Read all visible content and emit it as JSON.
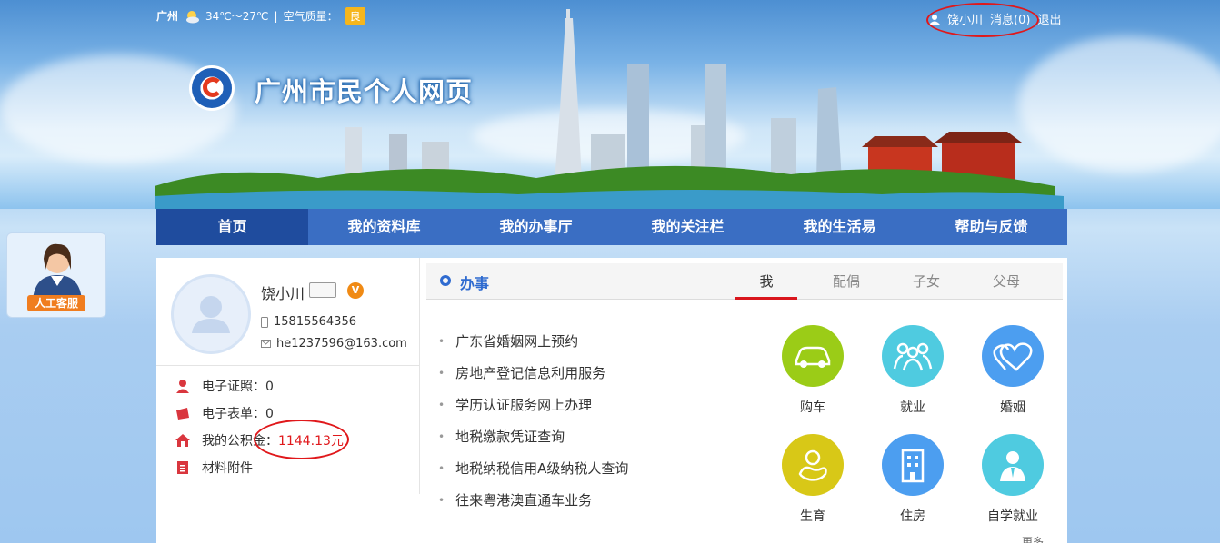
{
  "top": {
    "city": "广州",
    "weather": "34℃～27℃",
    "separator": "|",
    "air_quality_label": "空气质量：",
    "air_quality_value": "良",
    "user": "饶小川",
    "messages": "消息(0)",
    "logout": "退出"
  },
  "site_title": "广州市民个人网页",
  "nav": [
    "首页",
    "我的资料库",
    "我的办事厅",
    "我的关注栏",
    "我的生活易",
    "帮助与反馈"
  ],
  "service_label": "人工客服",
  "profile": {
    "name": "饶小川",
    "badge": "V",
    "phone": "15815564356",
    "email": "he1237596@163.com"
  },
  "stats": [
    {
      "label": "电子证照：",
      "value": "0"
    },
    {
      "label": "电子表单：",
      "value": "0"
    },
    {
      "label": "我的公积金：",
      "value": "1144.13元"
    },
    {
      "label": "材料附件",
      "value": ""
    }
  ],
  "affairs": {
    "title": "办事",
    "tabs": [
      "我",
      "配偶",
      "子女",
      "父母"
    ],
    "items": [
      "广东省婚姻网上预约",
      "房地产登记信息利用服务",
      "学历认证服务网上办理",
      "地税缴款凭证查询",
      "地税纳税信用A级纳税人查询",
      "往来粤港澳直通车业务"
    ],
    "services": [
      {
        "name": "购车",
        "icon": "car-icon",
        "color": "#9bcc17"
      },
      {
        "name": "就业",
        "icon": "people-icon",
        "color": "#4fcbe0"
      },
      {
        "name": "婚姻",
        "icon": "hearts-icon",
        "color": "#4c9ef0"
      },
      {
        "name": "生育",
        "icon": "baby-icon",
        "color": "#d8c817"
      },
      {
        "name": "住房",
        "icon": "building-icon",
        "color": "#4c9ef0"
      },
      {
        "name": "自学就业",
        "icon": "person-icon",
        "color": "#4fcbe0"
      }
    ],
    "more": "更多"
  }
}
